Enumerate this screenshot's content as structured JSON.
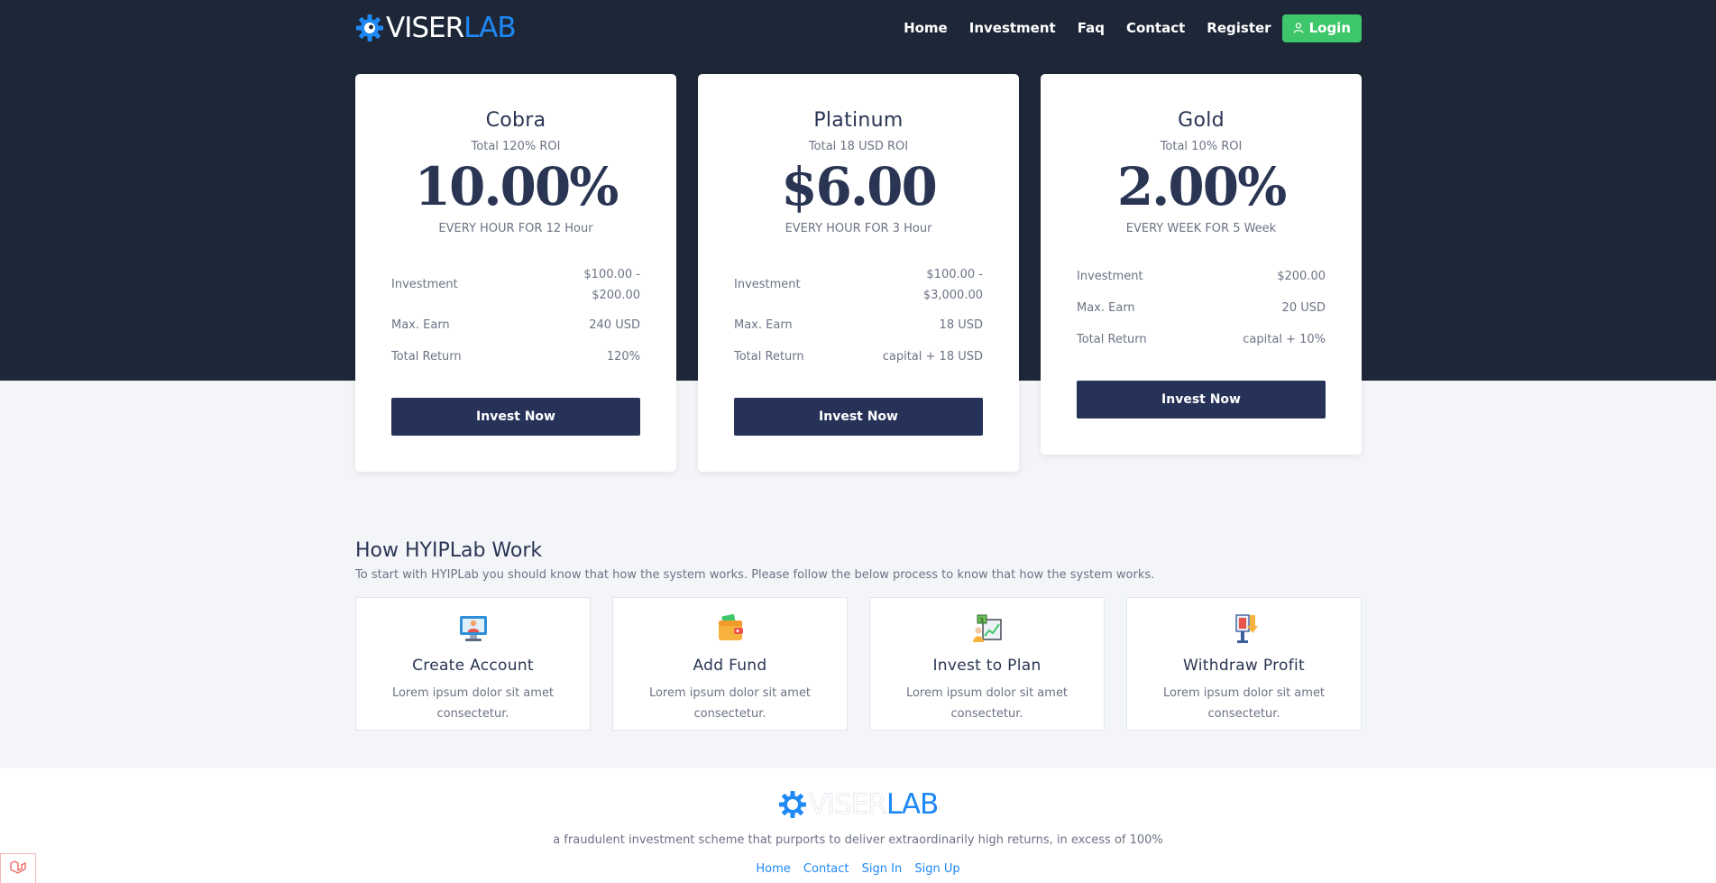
{
  "brand": {
    "logo_part1": "VISER",
    "logo_part2": "LAB"
  },
  "nav": {
    "items": [
      "Home",
      "Investment",
      "Faq",
      "Contact",
      "Register"
    ],
    "login_label": "Login"
  },
  "plans": [
    {
      "name": "Cobra",
      "roi": "Total 120% ROI",
      "rate": "10.00%",
      "period": "EVERY HOUR FOR 12 Hour",
      "investment_label": "Investment",
      "investment_value": "$100.00 - $200.00",
      "max_earn_label": "Max. Earn",
      "max_earn_value": "240 USD",
      "total_return_label": "Total Return",
      "total_return_value": "120%",
      "button": "Invest Now"
    },
    {
      "name": "Platinum",
      "roi": "Total 18 USD ROI",
      "rate": "$6.00",
      "period": "EVERY HOUR FOR 3 Hour",
      "investment_label": "Investment",
      "investment_value": "$100.00 - $3,000.00",
      "max_earn_label": "Max. Earn",
      "max_earn_value": "18 USD",
      "total_return_label": "Total Return",
      "total_return_value": "capital + 18 USD",
      "button": "Invest Now"
    },
    {
      "name": "Gold",
      "roi": "Total 10% ROI",
      "rate": "2.00%",
      "period": "EVERY WEEK FOR 5 Week",
      "investment_label": "Investment",
      "investment_value": "$200.00",
      "max_earn_label": "Max. Earn",
      "max_earn_value": "20 USD",
      "total_return_label": "Total Return",
      "total_return_value": "capital + 10%",
      "button": "Invest Now"
    }
  ],
  "how": {
    "title": "How HYIPLab Work",
    "subtitle": "To start with HYIPLab you should know that how the system works. Please follow the below process to know that how the system works.",
    "steps": [
      {
        "title": "Create Account",
        "desc": "Lorem ipsum dolor sit amet consectetur.",
        "icon": "create-account-icon"
      },
      {
        "title": "Add Fund",
        "desc": "Lorem ipsum dolor sit amet consectetur.",
        "icon": "wallet-icon"
      },
      {
        "title": "Invest to Plan",
        "desc": "Lorem ipsum dolor sit amet consectetur.",
        "icon": "invest-chart-icon"
      },
      {
        "title": "Withdraw Profit",
        "desc": "Lorem ipsum dolor sit amet consectetur.",
        "icon": "withdraw-icon"
      }
    ]
  },
  "footer": {
    "description": "a fraudulent investment scheme that purports to deliver extraordinarily high returns, in excess of 100%",
    "links": [
      "Home",
      "Contact",
      "Sign In",
      "Sign Up"
    ]
  },
  "colors": {
    "hero_bg": "#1e2738",
    "accent_blue": "#1e88f5",
    "login_green": "#3ec76a",
    "button_navy": "#273259"
  }
}
